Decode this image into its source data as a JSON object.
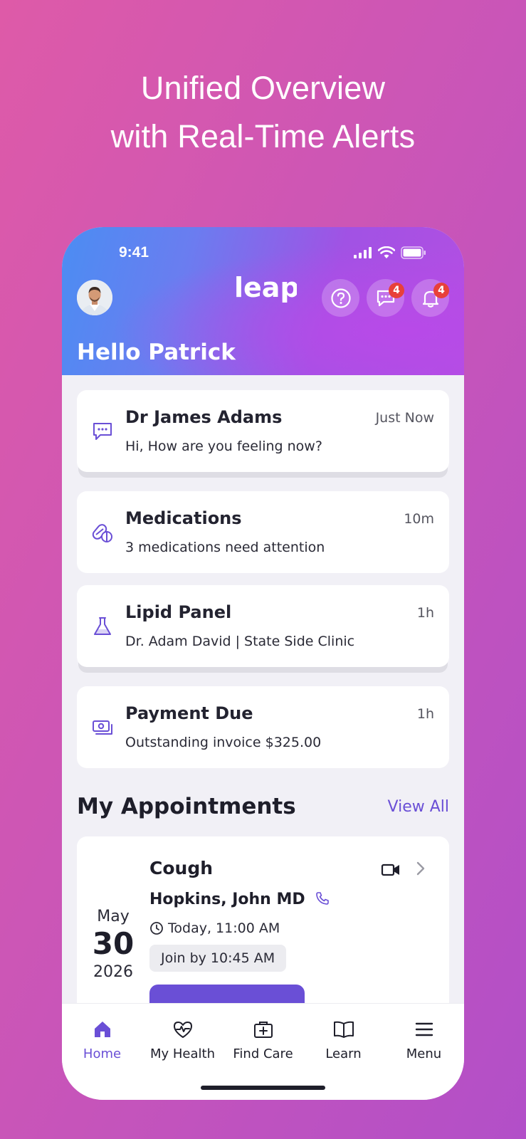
{
  "marketing": {
    "headline_line1": "Unified Overview",
    "headline_line2": "with Real-Time Alerts"
  },
  "status_bar": {
    "time": "9:41"
  },
  "header": {
    "logo": "leap",
    "messages_badge": "4",
    "notifications_badge": "4",
    "greeting": "Hello Patrick"
  },
  "alerts": [
    {
      "title": "Dr James Adams",
      "subtitle": "Hi, How are you feeling now?",
      "time": "Just Now",
      "icon": "chat-icon"
    },
    {
      "title": "Medications",
      "subtitle": "3 medications need attention",
      "time": "10m",
      "icon": "pills-icon"
    },
    {
      "title": "Lipid Panel",
      "subtitle": "Dr. Adam David | State Side Clinic",
      "time": "1h",
      "icon": "flask-icon"
    },
    {
      "title": "Payment Due",
      "subtitle": "Outstanding invoice $325.00",
      "time": "1h",
      "icon": "cash-icon"
    }
  ],
  "appointments": {
    "section_title": "My Appointments",
    "view_all": "View All",
    "items": [
      {
        "month": "May",
        "day": "30",
        "year": "2026",
        "title": "Cough",
        "doctor": "Hopkins, John MD",
        "time": "Today, 11:00 AM",
        "join": "Join by 10:45 AM"
      }
    ]
  },
  "tabbar": {
    "tabs": [
      {
        "label": "Home",
        "icon": "home-icon",
        "active": true
      },
      {
        "label": "My Health",
        "icon": "heart-pulse-icon",
        "active": false
      },
      {
        "label": "Find Care",
        "icon": "medical-bag-icon",
        "active": false
      },
      {
        "label": "Learn",
        "icon": "book-icon",
        "active": false
      },
      {
        "label": "Menu",
        "icon": "menu-icon",
        "active": false
      }
    ]
  },
  "colors": {
    "accent": "#6a4fd6",
    "badge": "#e8403a",
    "background_start": "#de5aa8",
    "background_end": "#b24fc8"
  }
}
